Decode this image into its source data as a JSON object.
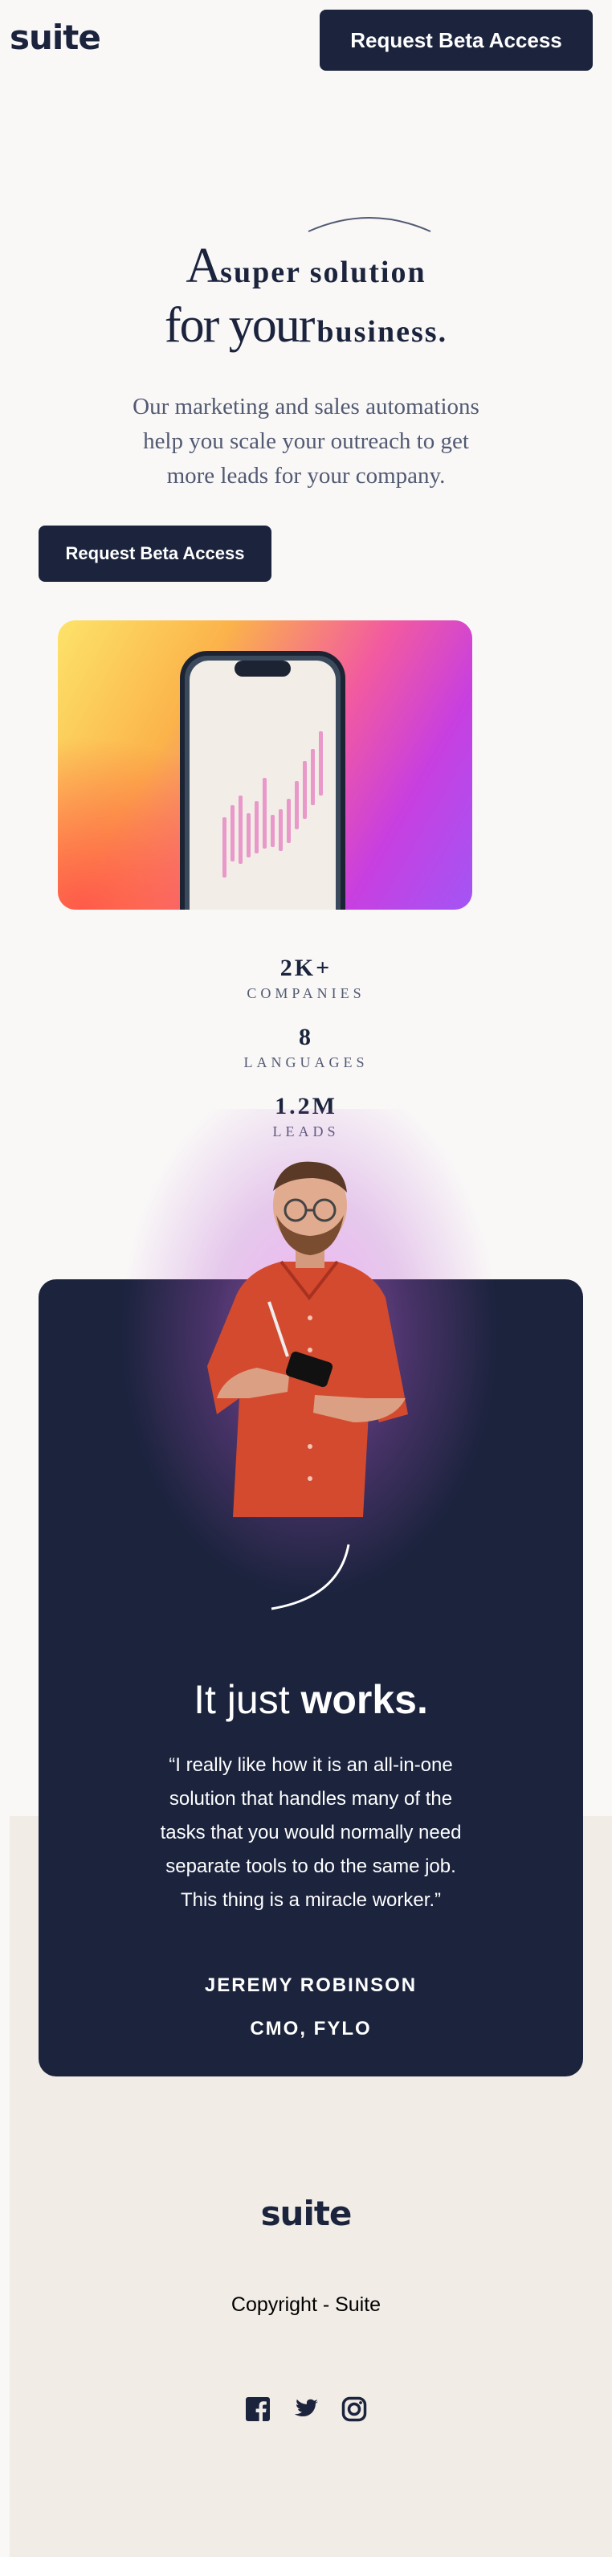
{
  "header": {
    "logo": "suite",
    "cta": "Request Beta Access"
  },
  "hero": {
    "title_line1_a": "A",
    "title_line1_b": "super solution",
    "title_line2_a": "for your",
    "title_line2_b": "business.",
    "subtitle": "Our marketing and sales automations help you scale your outreach to get more leads for your company.",
    "cta": "Request Beta Access"
  },
  "stats": [
    {
      "value": "2K+",
      "label": "COMPANIES"
    },
    {
      "value": "8",
      "label": "LANGUAGES"
    },
    {
      "value": "1.2M",
      "label": "LEADS"
    }
  ],
  "testimonial": {
    "heading_light": "It just ",
    "heading_bold": "works.",
    "quote": "“I really like how it is an all-in-one solution that handles many of the tasks that you would normally need separate tools to do the same job. This thing is a miracle worker.”",
    "name": "JEREMY ROBINSON",
    "role": "CMO, FYLO"
  },
  "footer": {
    "logo": "suite",
    "copyright": "Copyright - Suite",
    "social_icons": [
      "facebook-icon",
      "twitter-icon",
      "instagram-icon"
    ]
  },
  "colors": {
    "navy": "#1b233d",
    "page_bg": "#f9f8f7",
    "footer_bg": "#f1ece6",
    "text_muted": "#525a72"
  }
}
